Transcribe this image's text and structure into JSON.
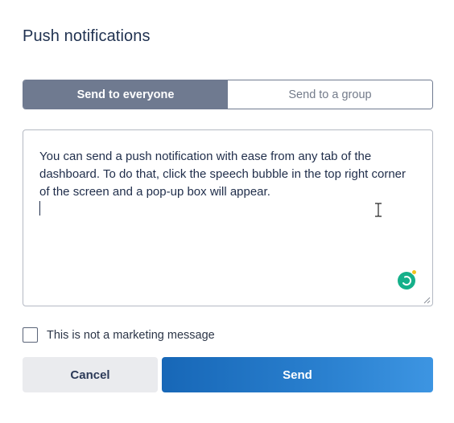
{
  "dialog": {
    "title": "Push notifications"
  },
  "audience": {
    "options": [
      {
        "label": "Send to everyone",
        "selected": true
      },
      {
        "label": "Send to a group",
        "selected": false
      }
    ]
  },
  "message": {
    "value": "You can send a push notification with ease from any tab of the dashboard. To do that, click the speech bubble in the top right corner of the screen and a pop-up box will appear."
  },
  "marketing": {
    "label": "This is not a marketing message",
    "checked": false
  },
  "actions": {
    "cancel_label": "Cancel",
    "send_label": "Send"
  },
  "colors": {
    "segment_active": "#6f7a90",
    "send_button": "#1f74c4",
    "cancel_button": "#eaebee",
    "assistant_badge": "#15b08a",
    "assistant_dot": "#f2c21b"
  },
  "icons": {
    "text_cursor": "i-beam-cursor-icon",
    "assistant": "writing-assistant-icon",
    "resize": "resize-handle-icon"
  }
}
